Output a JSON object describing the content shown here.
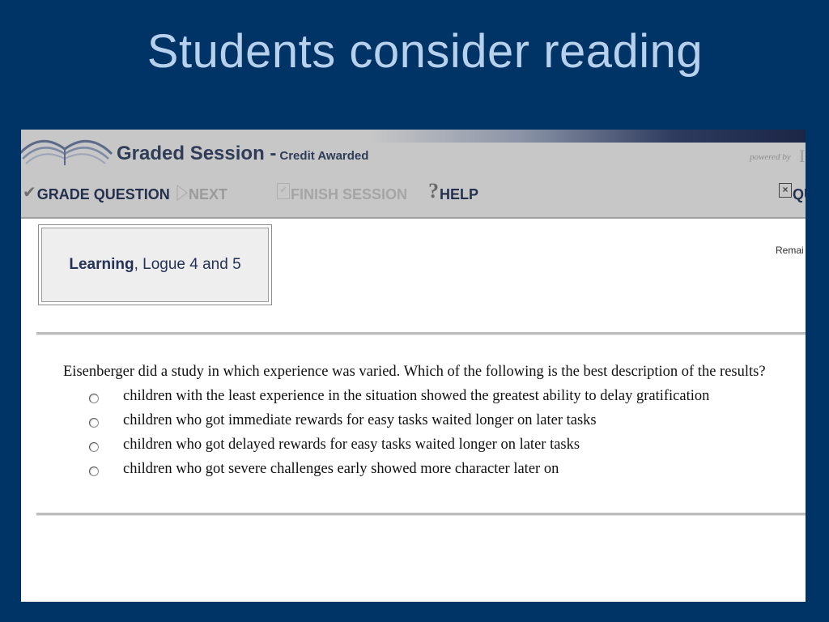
{
  "slide": {
    "title": "Students consider reading"
  },
  "header": {
    "session_title": "Graded Session -",
    "session_subtitle": "Credit Awarded",
    "powered_by": "powered by",
    "powered_mark": "I"
  },
  "toolbar": {
    "grade_label": "GRADE QUESTION",
    "next_label": "NEXT",
    "finish_label": "FINISH SESSION",
    "help_label": "HELP",
    "quit_label": "QU",
    "help_glyph": "?",
    "check_glyph": "✔",
    "close_glyph": "×"
  },
  "course": {
    "name": "Learning",
    "detail": ", Logue 4 and 5"
  },
  "remaining_label": "Remai",
  "question": {
    "text": "Eisenberger did a study in which experience was varied. Which of the following is the best description of the results?",
    "options": [
      "children with the least experience in the situation showed the greatest ability to delay gratification",
      "children who got immediate rewards for easy tasks waited longer on later tasks",
      "children who got delayed rewards for easy tasks waited longer on later tasks",
      "children who got severe challenges early showed more character later on"
    ]
  },
  "icons": {
    "book": "book-icon",
    "check": "check-icon",
    "next": "next-arrow-icon",
    "finish": "finish-icon",
    "help": "help-icon",
    "quit": "close-icon"
  },
  "colors": {
    "slide_bg": "#003366",
    "title": "#b7d0ec",
    "header_bg": "#c7c7c7",
    "header_text": "#2f3d59"
  }
}
